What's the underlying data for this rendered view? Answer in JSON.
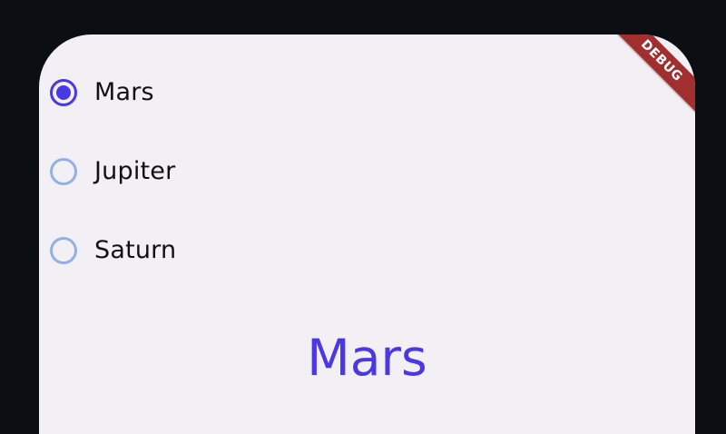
{
  "radio_group": {
    "options": [
      {
        "label": "Mars",
        "selected": true
      },
      {
        "label": "Jupiter",
        "selected": false
      },
      {
        "label": "Saturn",
        "selected": false
      }
    ]
  },
  "selected_display": {
    "text": "Mars"
  },
  "debug_banner": {
    "text": "DEBUG"
  },
  "colors": {
    "background": "#0b0f14",
    "surface": "#f2f0f4",
    "accent": "#4a37e6",
    "radio_unselected": "#93b0e6",
    "banner": "#a12f2f"
  }
}
